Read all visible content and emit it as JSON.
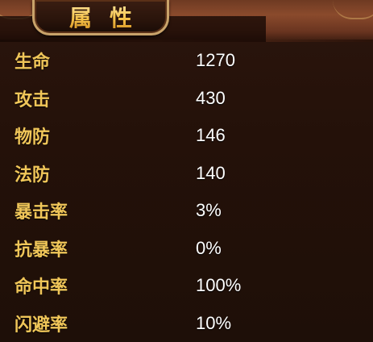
{
  "panel": {
    "title": "属性"
  },
  "attributes": [
    {
      "label": "生命",
      "value": "1270"
    },
    {
      "label": "攻击",
      "value": "430"
    },
    {
      "label": "物防",
      "value": "146"
    },
    {
      "label": "法防",
      "value": "140"
    },
    {
      "label": "暴击率",
      "value": "3%"
    },
    {
      "label": "抗暴率",
      "value": "0%"
    },
    {
      "label": "命中率",
      "value": "100%"
    },
    {
      "label": "闪避率",
      "value": "10%"
    }
  ],
  "colors": {
    "label": "#f0c659",
    "value": "#ffffff",
    "background": "#241109",
    "plaque_border": "#c9a36a"
  }
}
